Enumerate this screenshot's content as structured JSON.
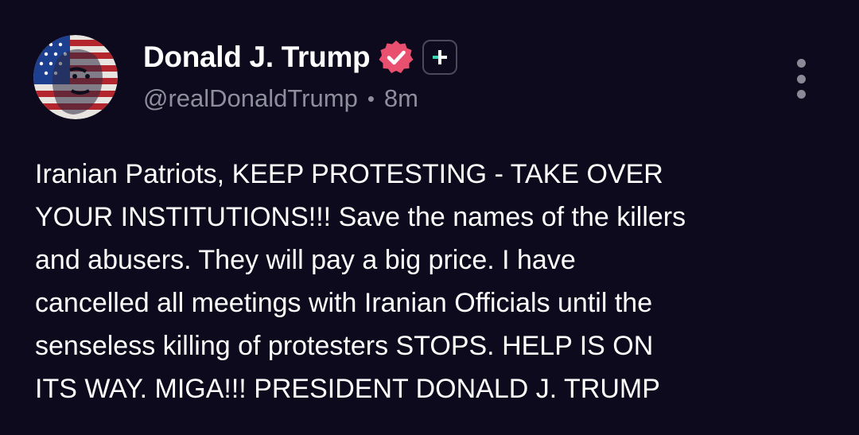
{
  "author": {
    "display_name": "Donald J. Trump",
    "handle": "@realDonaldTrump",
    "separator": "•",
    "timestamp": "8m",
    "avatar_icon": "flag-portrait-avatar",
    "verified_icon": "verified-check-badge-icon",
    "follow_icon": "plus-icon"
  },
  "post": {
    "lines": [
      "Iranian Patriots, KEEP PROTESTING - TAKE OVER",
      "YOUR INSTITUTIONS!!! Save the names of the killers",
      "and abusers. They will pay a big price. I have",
      "cancelled all meetings with Iranian Officials until the",
      "senseless killing of protesters STOPS. HELP IS ON",
      "ITS WAY. MIGA!!! PRESIDENT DONALD J. TRUMP"
    ]
  },
  "actions": {
    "more_icon": "more-vertical-icon"
  },
  "colors": {
    "background": "#0c0a1c",
    "text_primary": "#ffffff",
    "text_secondary": "#8e8e9c",
    "verified_badge": "#e94f6e",
    "follow_plus_accent": "#3fd4b0"
  }
}
